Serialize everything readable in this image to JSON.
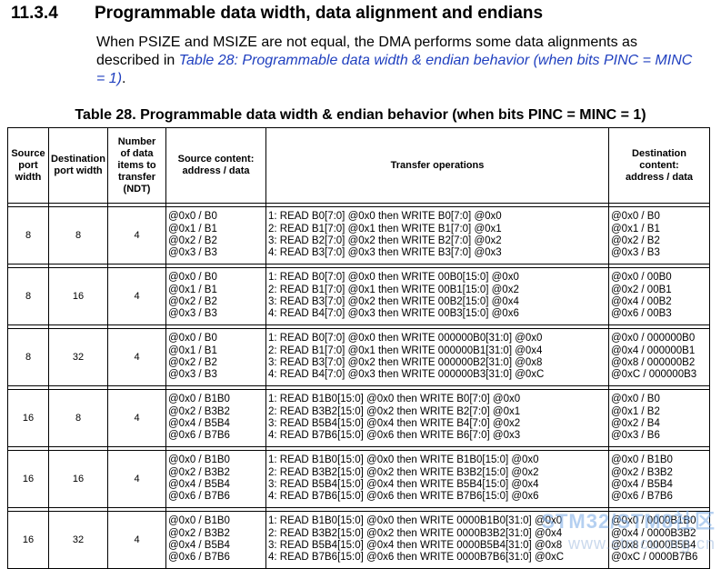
{
  "section": {
    "number": "11.3.4",
    "title": "Programmable data width, data alignment and endians"
  },
  "intro": {
    "text_before": "When PSIZE and MSIZE are not equal, the DMA performs some data alignments as described in ",
    "link": "Table 28: Programmable data width & endian behavior (when bits PINC = MINC = 1)",
    "text_after": "."
  },
  "table": {
    "caption": "Table 28. Programmable data width & endian behavior (when bits PINC = MINC = 1)",
    "headers": {
      "source_width": [
        "Source",
        "port",
        "width"
      ],
      "dest_width": [
        "Destination",
        "port width"
      ],
      "ndt": [
        "Number",
        "of data",
        "items to",
        "transfer",
        "(NDT)"
      ],
      "source_content": [
        "Source content:",
        "address / data"
      ],
      "transfer_ops": [
        "Transfer operations"
      ],
      "dest_content": [
        "Destination",
        "content:",
        "address / data"
      ]
    },
    "rows": [
      {
        "src_width": "8",
        "dst_width": "8",
        "ndt": "4",
        "source": [
          "@0x0 / B0",
          "@0x1 / B1",
          "@0x2 / B2",
          "@0x3 / B3"
        ],
        "ops": [
          "1: READ B0[7:0] @0x0 then WRITE B0[7:0] @0x0",
          "2: READ B1[7:0] @0x1 then WRITE B1[7:0] @0x1",
          "3: READ B2[7:0] @0x2 then WRITE B2[7:0] @0x2",
          "4: READ B3[7:0] @0x3 then WRITE B3[7:0] @0x3"
        ],
        "dest": [
          "@0x0 / B0",
          "@0x1 / B1",
          "@0x2 / B2",
          "@0x3 / B3"
        ]
      },
      {
        "src_width": "8",
        "dst_width": "16",
        "ndt": "4",
        "source": [
          "@0x0 / B0",
          "@0x1 / B1",
          "@0x2 / B2",
          "@0x3 / B3"
        ],
        "ops": [
          "1: READ B0[7:0] @0x0 then WRITE 00B0[15:0] @0x0",
          "2: READ B1[7:0] @0x1 then WRITE 00B1[15:0] @0x2",
          "3: READ B3[7:0] @0x2 then WRITE 00B2[15:0] @0x4",
          "4: READ B4[7:0] @0x3 then WRITE 00B3[15:0] @0x6"
        ],
        "dest": [
          "@0x0 / 00B0",
          "@0x2 / 00B1",
          "@0x4 / 00B2",
          "@0x6 / 00B3"
        ]
      },
      {
        "src_width": "8",
        "dst_width": "32",
        "ndt": "4",
        "source": [
          "@0x0 / B0",
          "@0x1 / B1",
          "@0x2 / B2",
          "@0x3 / B3"
        ],
        "ops": [
          "1: READ B0[7:0] @0x0 then WRITE 000000B0[31:0] @0x0",
          "2: READ B1[7:0] @0x1 then WRITE 000000B1[31:0] @0x4",
          "3: READ B3[7:0] @0x2 then WRITE 000000B2[31:0] @0x8",
          "4: READ B4[7:0] @0x3 then WRITE 000000B3[31:0] @0xC"
        ],
        "dest": [
          "@0x0 / 000000B0",
          "@0x4 / 000000B1",
          "@0x8 / 000000B2",
          "@0xC / 000000B3"
        ]
      },
      {
        "src_width": "16",
        "dst_width": "8",
        "ndt": "4",
        "source": [
          "@0x0 / B1B0",
          "@0x2 / B3B2",
          "@0x4 / B5B4",
          "@0x6 / B7B6"
        ],
        "ops": [
          "1: READ B1B0[15:0] @0x0 then WRITE B0[7:0] @0x0",
          "2: READ B3B2[15:0] @0x2 then WRITE B2[7:0] @0x1",
          "3: READ B5B4[15:0] @0x4 then WRITE B4[7:0] @0x2",
          "4: READ B7B6[15:0] @0x6 then WRITE B6[7:0] @0x3"
        ],
        "dest": [
          "@0x0 / B0",
          "@0x1 / B2",
          "@0x2 / B4",
          "@0x3 / B6"
        ]
      },
      {
        "src_width": "16",
        "dst_width": "16",
        "ndt": "4",
        "source": [
          "@0x0 / B1B0",
          "@0x2 / B3B2",
          "@0x4 / B5B4",
          "@0x6 / B7B6"
        ],
        "ops": [
          "1: READ B1B0[15:0] @0x0 then WRITE B1B0[15:0] @0x0",
          "2: READ B3B2[15:0] @0x2 then WRITE B3B2[15:0] @0x2",
          "3: READ B5B4[15:0] @0x4 then WRITE B5B4[15:0] @0x4",
          "4: READ B7B6[15:0] @0x6 then WRITE B7B6[15:0] @0x6"
        ],
        "dest": [
          "@0x0 / B1B0",
          "@0x2 / B3B2",
          "@0x4 / B5B4",
          "@0x6 / B7B6"
        ]
      },
      {
        "src_width": "16",
        "dst_width": "32",
        "ndt": "4",
        "source": [
          "@0x0 / B1B0",
          "@0x2 / B3B2",
          "@0x4 / B5B4",
          "@0x6 / B7B6"
        ],
        "ops": [
          "1: READ B1B0[15:0] @0x0 then WRITE 0000B1B0[31:0] @0x0",
          "2: READ B3B2[15:0] @0x2 then WRITE 0000B3B2[31:0] @0x4",
          "3: READ B5B4[15:0] @0x4 then WRITE 0000B5B4[31:0] @0x8",
          "4: READ B7B6[15:0] @0x6 then WRITE 0000B7B6[31:0] @0xC"
        ],
        "dest": [
          "@0x0 / 0000B1B0",
          "@0x4 / 0000B3B2",
          "@0x8 / 0000B5B4",
          "@0xC / 0000B7B6"
        ]
      }
    ]
  },
  "watermark": {
    "text": "STM32/STM8社区",
    "sub": "www.stmcu.org.cn"
  }
}
